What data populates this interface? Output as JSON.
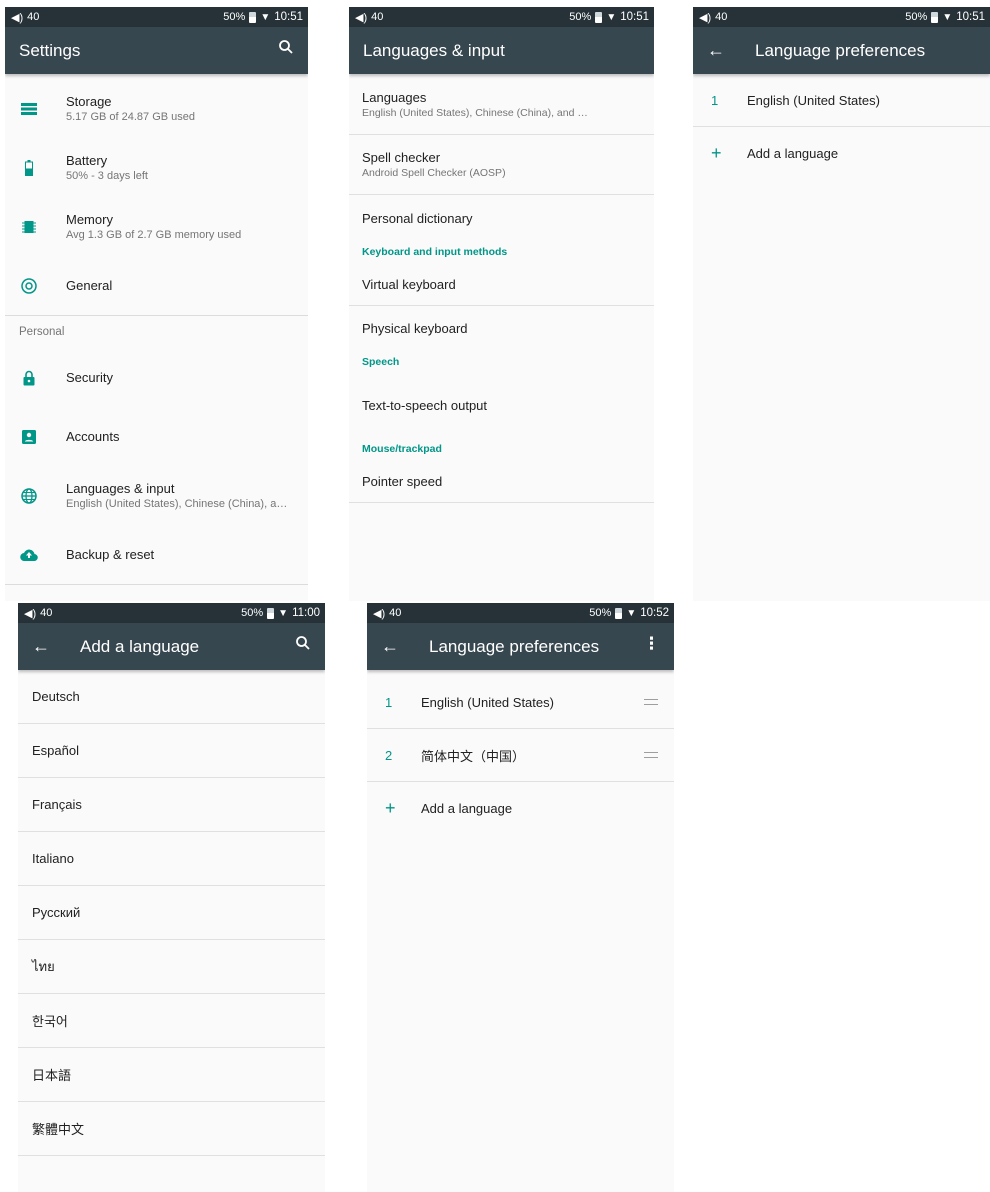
{
  "status": {
    "volume_label": "40",
    "battery_pct": "50%",
    "times": [
      "10:51",
      "10:51",
      "10:51",
      "11:00",
      "10:52"
    ]
  },
  "screen1": {
    "title": "Settings",
    "items_top": [
      {
        "title": "Storage",
        "subtitle": "5.17 GB of 24.87 GB used",
        "icon": "storage-icon"
      },
      {
        "title": "Battery",
        "subtitle": "50% - 3 days left",
        "icon": "battery-icon"
      },
      {
        "title": "Memory",
        "subtitle": "Avg 1.3 GB of 2.7 GB memory used",
        "icon": "memory-icon"
      },
      {
        "title": "General",
        "subtitle": "",
        "icon": "general-icon"
      }
    ],
    "section_personal": "Personal",
    "items_personal": [
      {
        "title": "Security",
        "subtitle": "",
        "icon": "lock-icon"
      },
      {
        "title": "Accounts",
        "subtitle": "",
        "icon": "account-icon"
      },
      {
        "title": "Languages & input",
        "subtitle": "English (United States), Chinese (China), and …",
        "icon": "globe-icon"
      },
      {
        "title": "Backup & reset",
        "subtitle": "",
        "icon": "cloud-upload-icon"
      }
    ]
  },
  "screen2": {
    "title": "Languages & input",
    "languages": {
      "title": "Languages",
      "subtitle": "English (United States), Chinese (China), and …"
    },
    "spell": {
      "title": "Spell checker",
      "subtitle": "Android Spell Checker (AOSP)"
    },
    "personal_dict": "Personal dictionary",
    "cat_keyboard": "Keyboard and input methods",
    "virtual_keyboard": "Virtual keyboard",
    "physical_keyboard": "Physical keyboard",
    "cat_speech": "Speech",
    "tts": "Text-to-speech output",
    "cat_mouse": "Mouse/trackpad",
    "pointer_speed": "Pointer speed"
  },
  "screen3": {
    "title": "Language preferences",
    "languages": [
      {
        "num": "1",
        "label": "English (United States)"
      }
    ],
    "add_label": "Add a language"
  },
  "screen4": {
    "title": "Add a language",
    "languages": [
      "Deutsch",
      "Español",
      "Français",
      "Italiano",
      "Русский",
      "ไทย",
      "한국어",
      "日本語",
      "繁體中文"
    ]
  },
  "screen5": {
    "title": "Language preferences",
    "languages": [
      {
        "num": "1",
        "label": "English (United States)"
      },
      {
        "num": "2",
        "label": "简体中文（中国）"
      }
    ],
    "add_label": "Add a language"
  },
  "colors": {
    "toolbar": "#37474f",
    "statusbar": "#263238",
    "accent": "#009688"
  }
}
